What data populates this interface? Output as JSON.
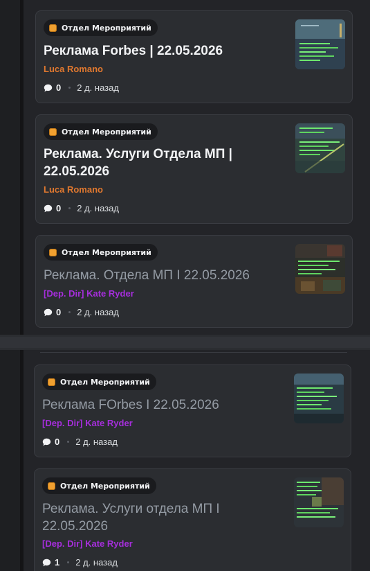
{
  "threads": [
    {
      "tag": "Отдел Мероприятий",
      "title": "Реклама Forbes | 22.05.2026",
      "author": "Luca Romano",
      "replies": "0",
      "time": "2 д. назад"
    },
    {
      "tag": "Отдел Мероприятий",
      "title": "Реклама. Услуги Отдела МП | 22.05.2026",
      "author": "Luca Romano",
      "replies": "0",
      "time": "2 д. назад"
    },
    {
      "tag": "Отдел Мероприятий",
      "title": "Реклама. Отдела МП I 22.05.2026",
      "author": "[Dep. Dir] Kate Ryder",
      "replies": "0",
      "time": "2 д. назад"
    },
    {
      "tag": "Отдел Мероприятий",
      "title": "Реклама FOrbes I 22.05.2026",
      "author": "[Dep. Dir] Kate Ryder",
      "replies": "0",
      "time": "2 д. назад"
    },
    {
      "tag": "Отдел Мероприятий",
      "title": "Реклама. Услуги отдела МП I 22.05.2026",
      "author": "[Dep. Dir] Kate Ryder",
      "replies": "1",
      "time": "2 д. назад"
    }
  ],
  "icons": {
    "tag": "orange-square-icon",
    "replies": "speech-bubble-icon"
  },
  "colors": {
    "tag_square": "#f0a030",
    "author_orange": "#e0782f",
    "author_purple": "#a52edb",
    "title_unread": "#f2f3f5",
    "title_read": "#949ba4"
  }
}
